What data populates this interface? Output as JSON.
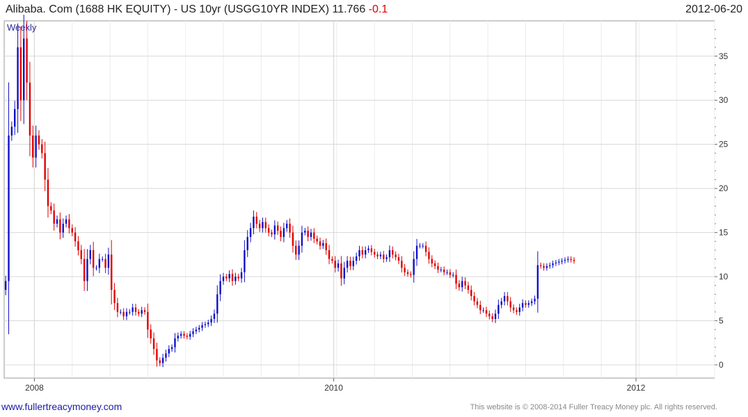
{
  "header": {
    "title": "Alibaba. Com (1688 HK EQUITY) - US 10yr (USGG10YR INDEX) 11.766",
    "change": "-0.1",
    "date": "2012-06-20"
  },
  "footer": {
    "link": "www.fullertreacymoney.com",
    "copyright": "This website is © 2008-2014 Fuller Treacy Money plc. All rights reserved."
  },
  "colors": {
    "up": "#1010c8",
    "down": "#e00000",
    "grid": "#d8d8d8"
  },
  "chart_data": {
    "type": "candlestick",
    "title": "Alibaba. Com (1688 HK EQUITY) - US 10yr (USGG10YR INDEX) 11.766 -0.1",
    "frequency_label": "Weekly",
    "x_ticks": [
      "2008",
      "2010",
      "2012"
    ],
    "y_ticks": [
      0,
      5,
      10,
      15,
      20,
      25,
      30,
      35
    ],
    "ylim": [
      -1.5,
      39
    ],
    "grid": true,
    "week_range": [
      0,
      235
    ],
    "x_tick_weeks": [
      10,
      109,
      209
    ],
    "weekly_close": [
      9.5,
      26,
      27,
      29,
      36,
      30,
      37,
      32,
      26,
      23.5,
      26,
      25,
      24,
      21,
      18,
      17.5,
      16,
      16.5,
      15,
      16,
      16.5,
      15.5,
      15,
      14,
      13,
      12,
      9.5,
      12,
      13,
      11,
      11,
      12,
      12,
      11,
      12.5,
      8.5,
      7,
      6,
      6,
      5.5,
      6,
      6,
      6.5,
      6,
      5.8,
      6.2,
      6,
      4,
      3,
      1.8,
      0.5,
      0.2,
      0.8,
      1.3,
      1.8,
      2,
      3,
      3.3,
      3.5,
      3.3,
      3.2,
      3.5,
      3.8,
      4,
      4.2,
      4.5,
      4.6,
      4.8,
      5.2,
      5.8,
      8,
      9.5,
      10,
      9.8,
      10.3,
      9.5,
      10,
      9.8,
      10.5,
      13,
      14.5,
      15.5,
      16.8,
      16,
      15.5,
      16.2,
      15.5,
      15,
      14.8,
      15.8,
      15.2,
      14.5,
      15.5,
      16,
      15,
      13.5,
      12.5,
      13.5,
      15,
      15.2,
      14.5,
      15,
      14.3,
      14,
      13.5,
      13.8,
      13,
      12,
      11.8,
      11,
      11.5,
      9.8,
      11,
      11.8,
      11.2,
      11.8,
      12.3,
      13,
      12.5,
      13,
      13.2,
      12.8,
      12.5,
      12.3,
      12.5,
      12,
      12.2,
      13,
      12.5,
      12.2,
      11.8,
      11,
      10.5,
      10.3,
      10.2,
      12,
      13.5,
      13.5,
      13.5,
      12.8,
      12,
      11.5,
      11.2,
      10.8,
      10.8,
      10.5,
      10.5,
      10.2,
      10.2,
      9.2,
      8.8,
      9.5,
      9,
      8.5,
      7.8,
      7.2,
      6.8,
      6.2,
      6.2,
      5.8,
      5.5,
      5.2,
      5.8,
      6.8,
      7.2,
      7.8,
      7.2,
      6.5,
      6.2,
      6,
      6.5,
      7,
      6.8,
      7,
      7.2,
      7.5,
      11.3,
      11.2,
      11,
      11.2,
      11.3,
      11.5,
      11.6,
      11.7,
      11.8,
      11.9,
      12,
      11.9,
      11.77
    ]
  }
}
